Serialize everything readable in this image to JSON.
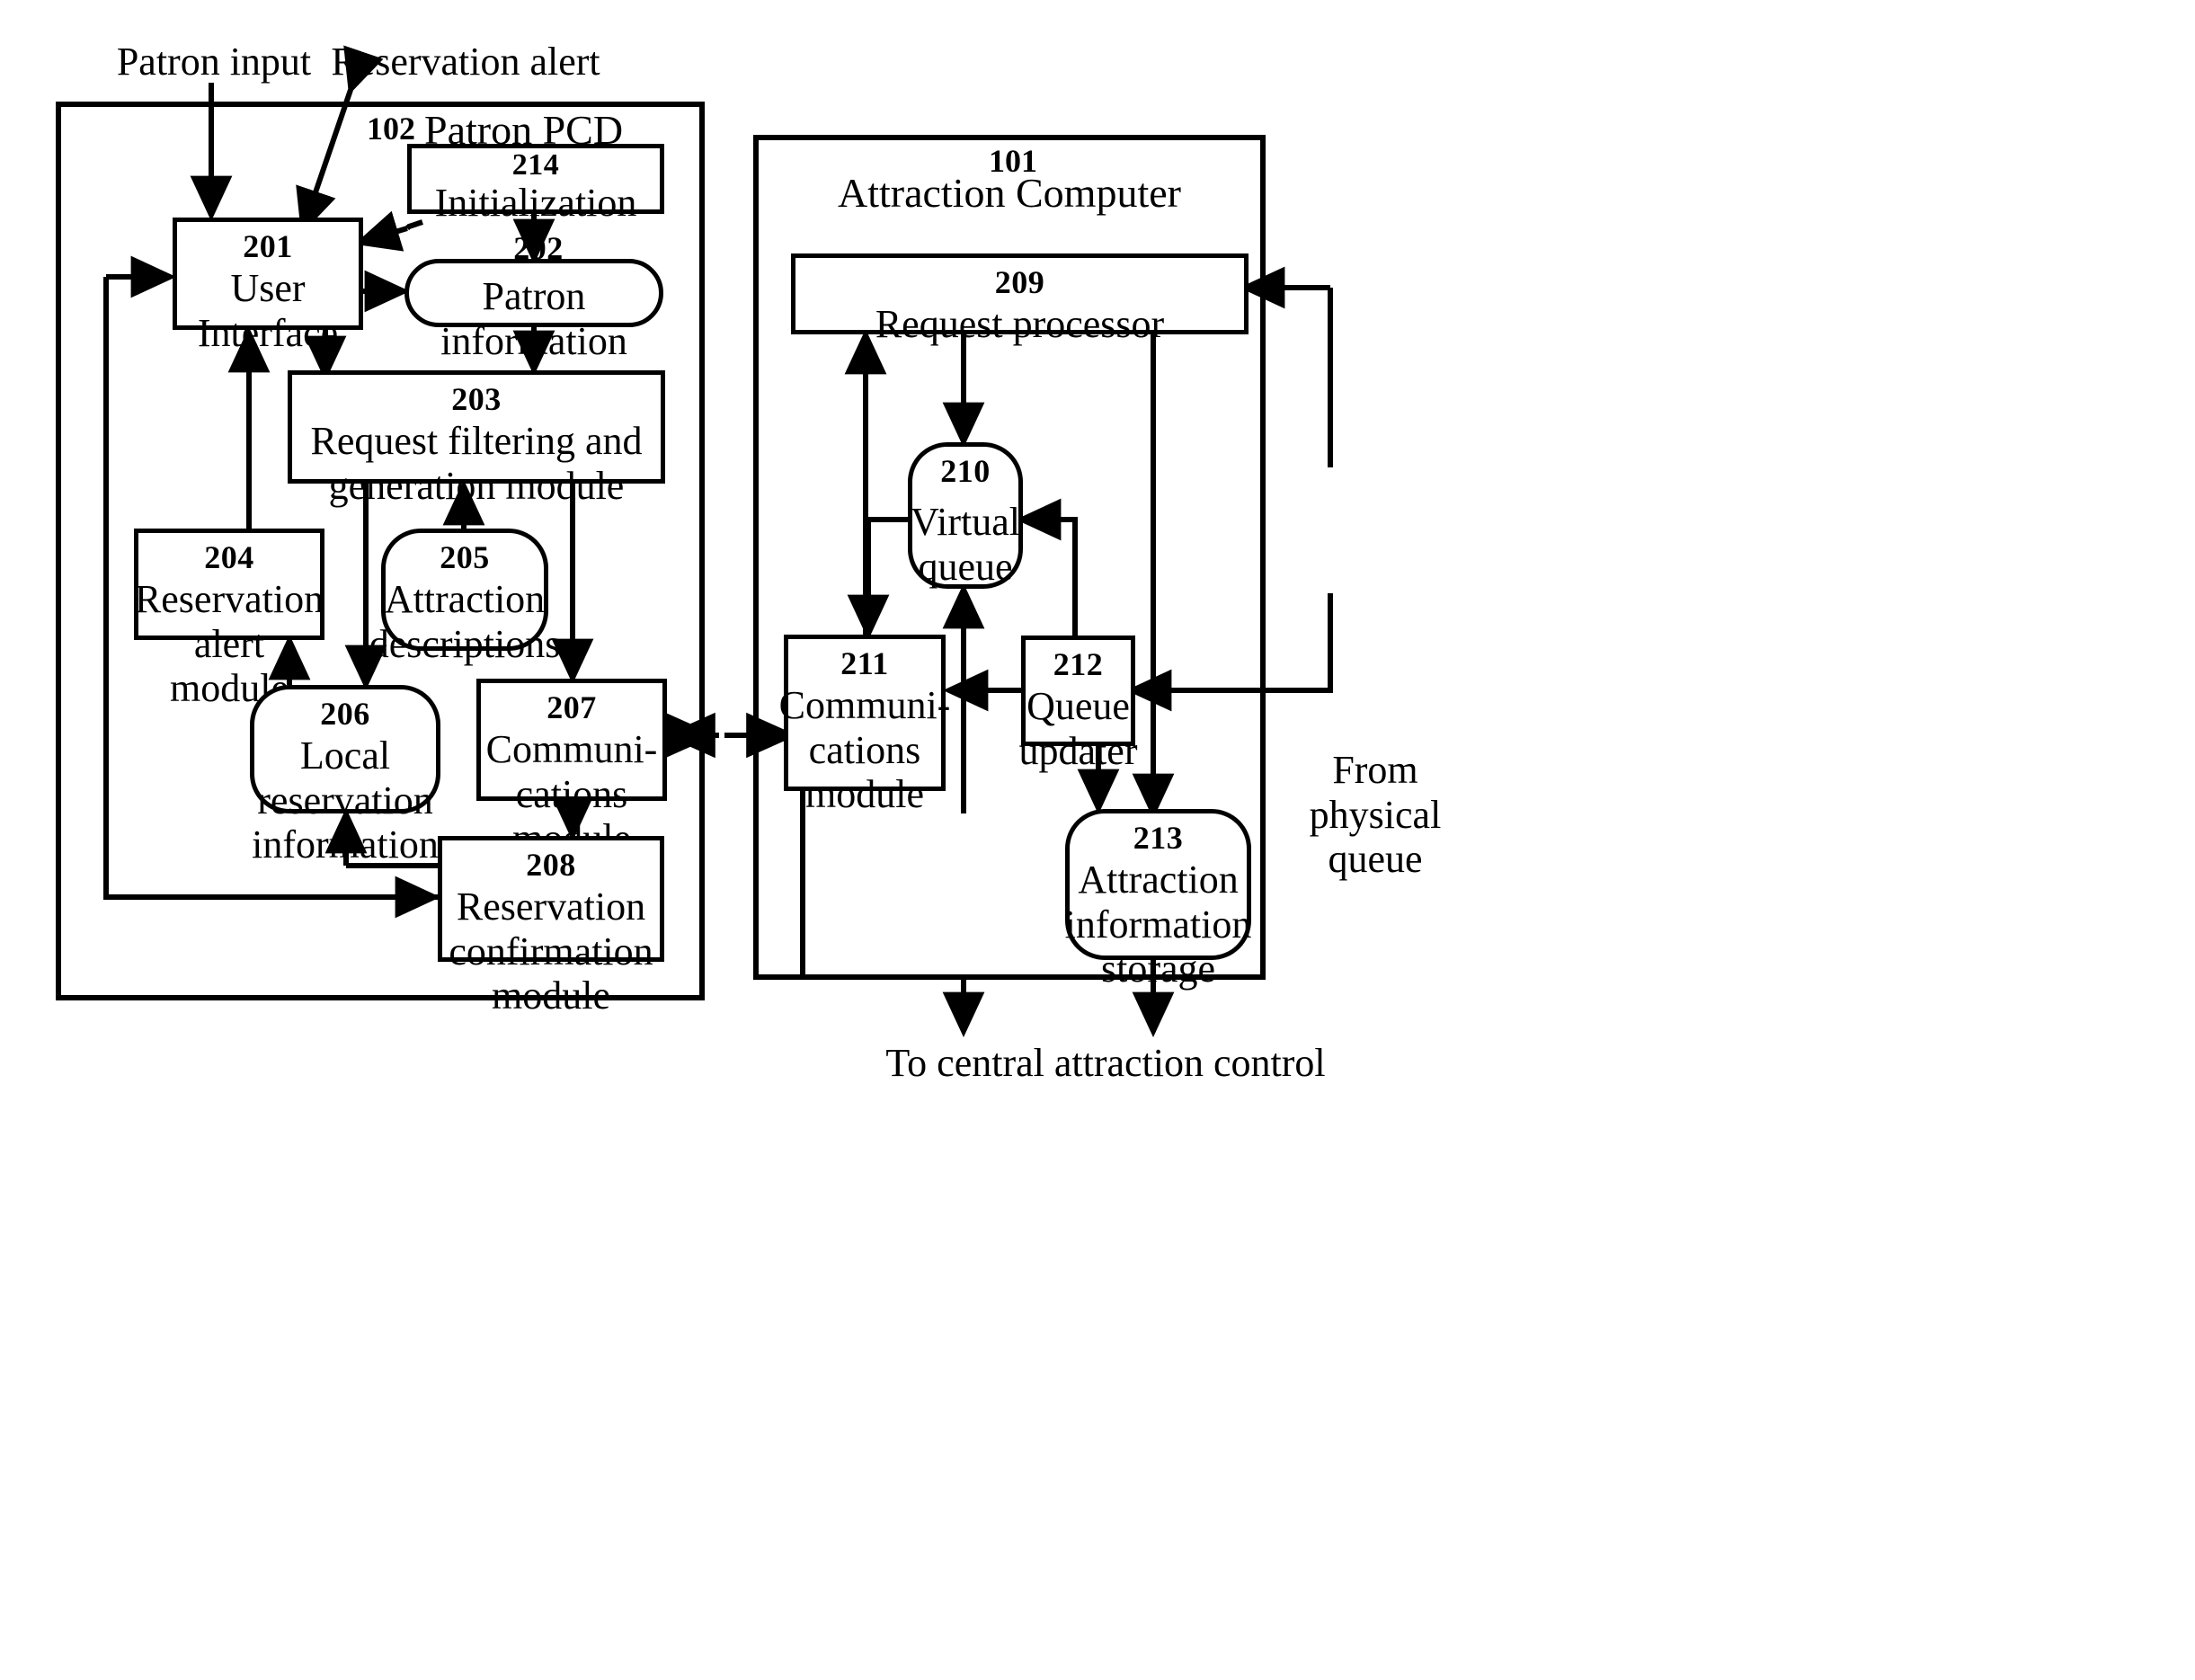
{
  "figure": {
    "type": "patent-block-diagram",
    "background": "#ffffff",
    "ink": "#000000"
  },
  "labels": {
    "patron_input": "Patron input",
    "reservation_alert": "Reservation alert",
    "from_physical_queue": "From\nphysical\nqueue",
    "to_central_attraction_control": "To central attraction control"
  },
  "containers": [
    {
      "ref": "102",
      "title": "Patron PCD"
    },
    {
      "ref": "101",
      "title": "Attraction Computer"
    }
  ],
  "nodes": {
    "n201": {
      "ref": "201",
      "title": "User Interface"
    },
    "n202": {
      "ref": "202",
      "title": "Patron  information"
    },
    "n203": {
      "ref": "203",
      "title": "Request filtering and\ngeneration module"
    },
    "n204": {
      "ref": "204",
      "title": "Reservation\nalert module"
    },
    "n205": {
      "ref": "205",
      "title": "Attraction\ndescriptions"
    },
    "n206": {
      "ref": "206",
      "title": "Local\nreservation\ninformation"
    },
    "n207": {
      "ref": "207",
      "title": "Communi-\ncations\nmodule"
    },
    "n208": {
      "ref": "208",
      "title": "Reservation\nconfirmation\nmodule"
    },
    "n209": {
      "ref": "209",
      "title": "Request processor"
    },
    "n210": {
      "ref": "210",
      "title": "Virtual\nqueue"
    },
    "n211": {
      "ref": "211",
      "title": "Communi-\ncations\nmodule"
    },
    "n212": {
      "ref": "212",
      "title": "Queue\nupdater"
    },
    "n213": {
      "ref": "213",
      "title": "Attraction\ninformation\nstorage"
    },
    "n214": {
      "ref": "214",
      "title": "Initialization"
    }
  }
}
